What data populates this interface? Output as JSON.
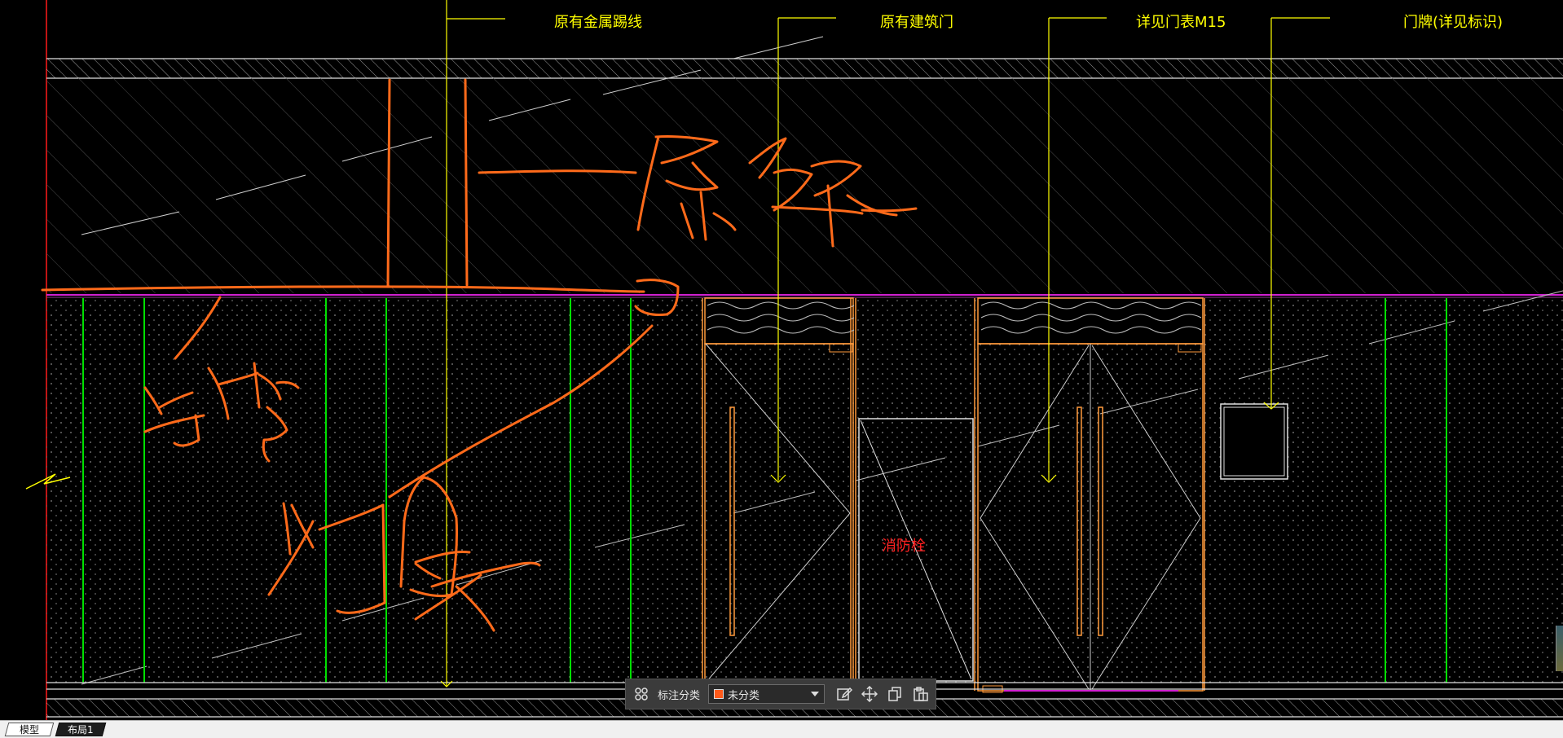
{
  "drawing": {
    "labels": {
      "metal_trim": "原有金属踢线",
      "existing_door": "原有建筑门",
      "door_table": "详见门表M15",
      "door_sign": "门牌(详见标识)",
      "hydrant": "消防栓"
    },
    "colors": {
      "background": "#000000",
      "outline": "#e0e0e0",
      "leader": "#ffff00",
      "panel_divider": "#00ff00",
      "door_frame": "#ff9a3c",
      "markup": "#ff6a1a",
      "magenta_line": "#d020d0",
      "hydrant_text": "#ff2020"
    }
  },
  "annotation_toolbar": {
    "grid_icon": "grid-icon",
    "category_label": "标注分类",
    "category_value": "未分类",
    "category_color": "#ff5a1a",
    "edit_icon": "edit-icon",
    "move_icon": "move-icon",
    "copy_icon": "copy-icon",
    "paste_icon": "paste-icon"
  },
  "layout_tabs": [
    {
      "label": "模型",
      "active": true
    },
    {
      "label": "布局1",
      "active": false
    }
  ]
}
